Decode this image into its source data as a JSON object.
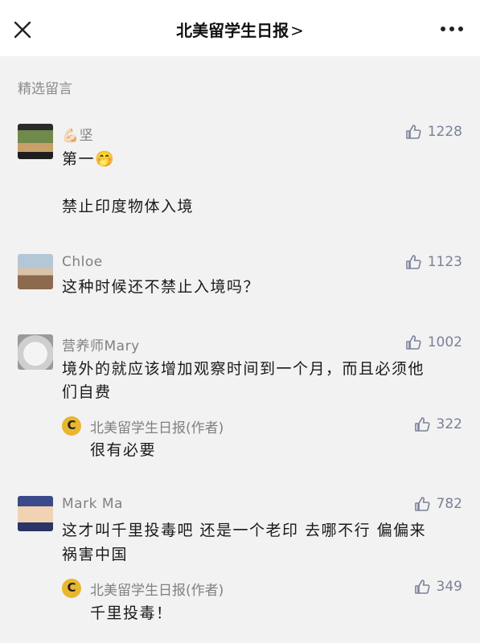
{
  "header": {
    "title": "北美留学生日报",
    "chevron": ">",
    "close_icon": "close-icon",
    "more_icon": "more-dots-icon"
  },
  "section": {
    "label": "精选留言"
  },
  "comments": [
    {
      "name": "💪🏻坚",
      "likes": "1228",
      "lines": [
        "第一🤭",
        "",
        "禁止印度物体入境"
      ]
    },
    {
      "name": "Chloe",
      "likes": "1123",
      "lines": [
        "这种时候还不禁止入境吗？"
      ]
    },
    {
      "name": "营养师Mary",
      "likes": "1002",
      "lines": [
        "境外的就应该增加观察时间到一个月，而且必须他",
        "们自费"
      ],
      "reply": {
        "name": "北美留学生日报(作者)",
        "likes": "322",
        "text": "很有必要"
      }
    },
    {
      "name": "Mark Ma",
      "likes": "782",
      "lines": [
        "这才叫千里投毒吧 还是一个老印 去哪不行 偏偏来",
        "祸害中国"
      ],
      "reply": {
        "name": "北美留学生日报(作者)",
        "likes": "349",
        "text": "千里投毒！"
      }
    }
  ],
  "colors": {
    "accent": "#7b8199",
    "badge": "#e8b730",
    "muted": "#808080"
  }
}
